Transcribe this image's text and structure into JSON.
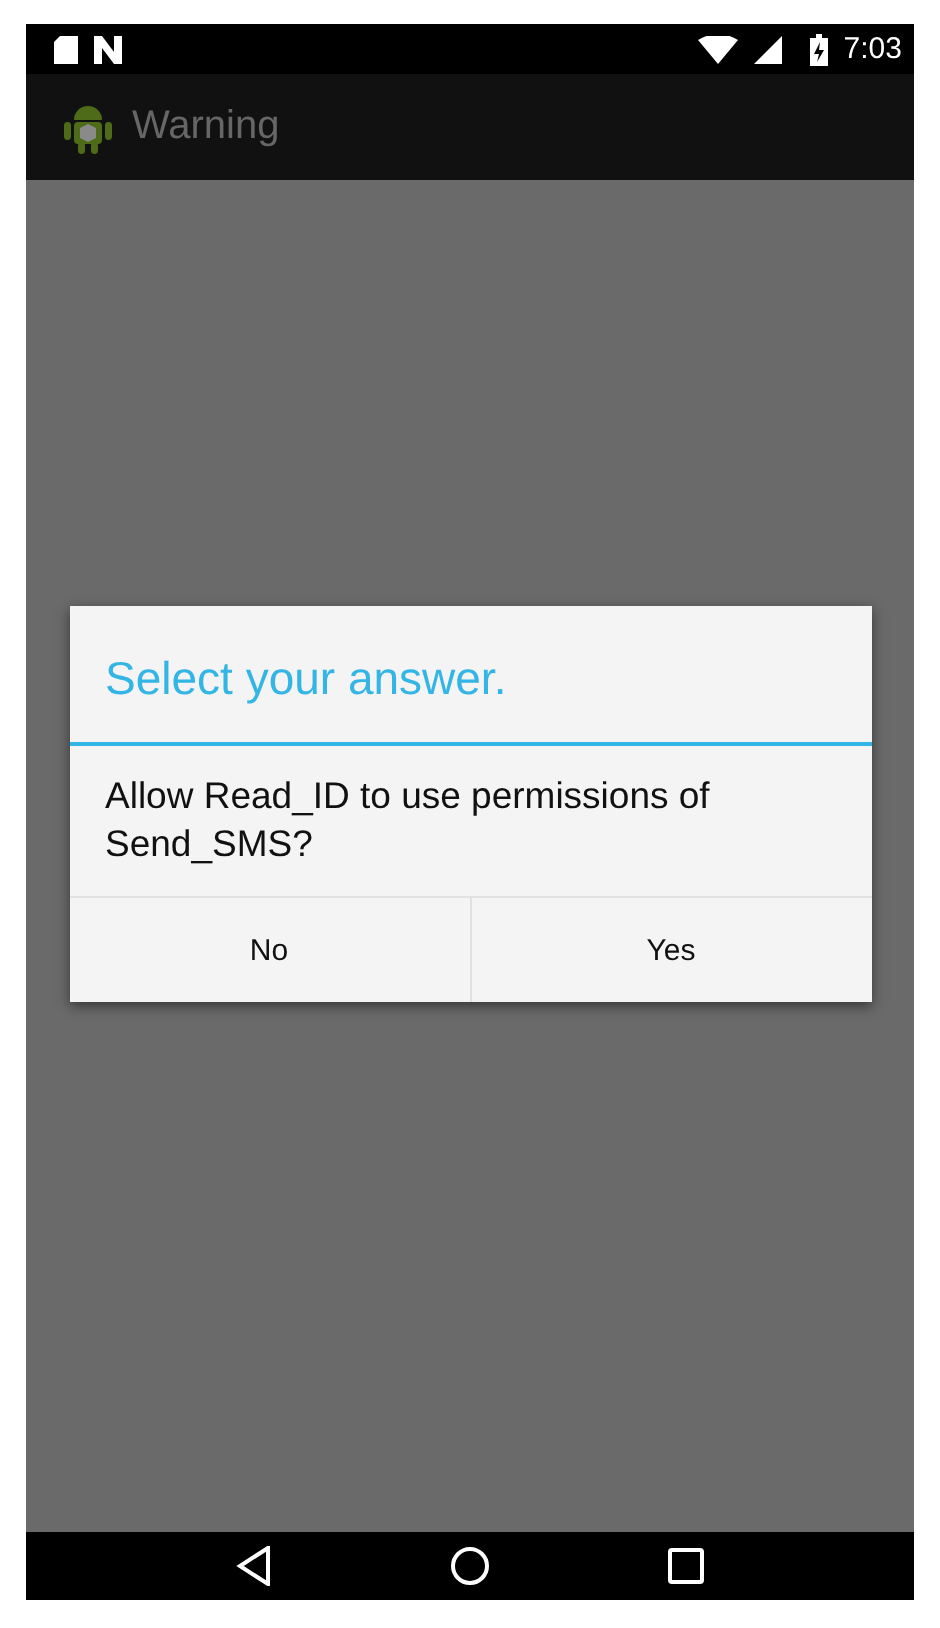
{
  "status_bar": {
    "time": "7:03"
  },
  "app_bar": {
    "title": "Warning"
  },
  "dialog": {
    "title": "Select your answer.",
    "message": "Allow Read_ID to use permissions of Send_SMS?",
    "buttons": [
      {
        "label": "No"
      },
      {
        "label": "Yes"
      }
    ]
  }
}
